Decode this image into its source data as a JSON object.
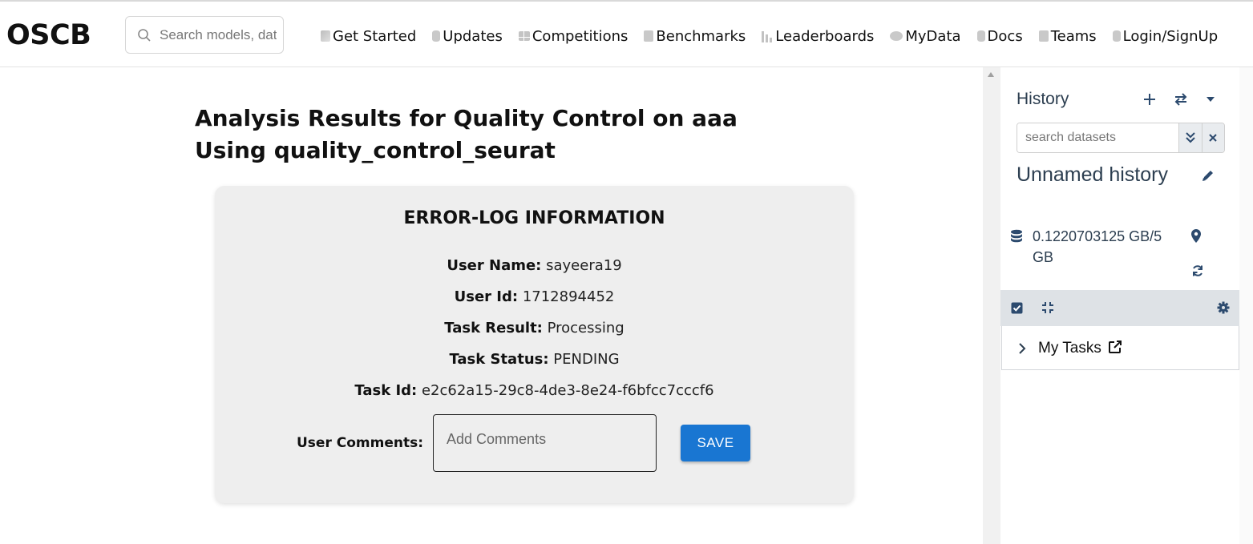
{
  "logo": "OSCB",
  "search": {
    "placeholder": "Search models, datasets"
  },
  "nav": [
    {
      "label": "Get Started",
      "icon": "cube-icon"
    },
    {
      "label": "Updates",
      "icon": "database-icon"
    },
    {
      "label": "Competitions",
      "icon": "grid-icon"
    },
    {
      "label": "Benchmarks",
      "icon": "clipboard-icon"
    },
    {
      "label": "Leaderboards",
      "icon": "bar-chart-icon"
    },
    {
      "label": "MyData",
      "icon": "disk-icon"
    },
    {
      "label": "Docs",
      "icon": "database-icon"
    },
    {
      "label": "Teams",
      "icon": "clipboard-icon"
    },
    {
      "label": "Login/SignUp",
      "icon": "database-icon"
    }
  ],
  "main": {
    "title": "Analysis Results for Quality Control on aaa Using quality_control_seurat",
    "card": {
      "heading": "ERROR-LOG INFORMATION",
      "fields": [
        {
          "label": "User Name:",
          "value": "sayeera19"
        },
        {
          "label": "User Id:",
          "value": "1712894452"
        },
        {
          "label": "Task Result:",
          "value": "Processing"
        },
        {
          "label": "Task Status:",
          "value": "PENDING"
        },
        {
          "label": "Task Id:",
          "value": "e2c62a15-29c8-4de3-8e24-f6bfcc7cccf6"
        }
      ],
      "comments_label": "User Comments:",
      "comments_placeholder": "Add Comments",
      "save_label": "SAVE"
    }
  },
  "history": {
    "title": "History",
    "search_placeholder": "search datasets",
    "name": "Unnamed history",
    "usage": "0.1220703125 GB/5 GB",
    "tasks_label": "My Tasks",
    "accent_color": "#2c4a6e"
  }
}
